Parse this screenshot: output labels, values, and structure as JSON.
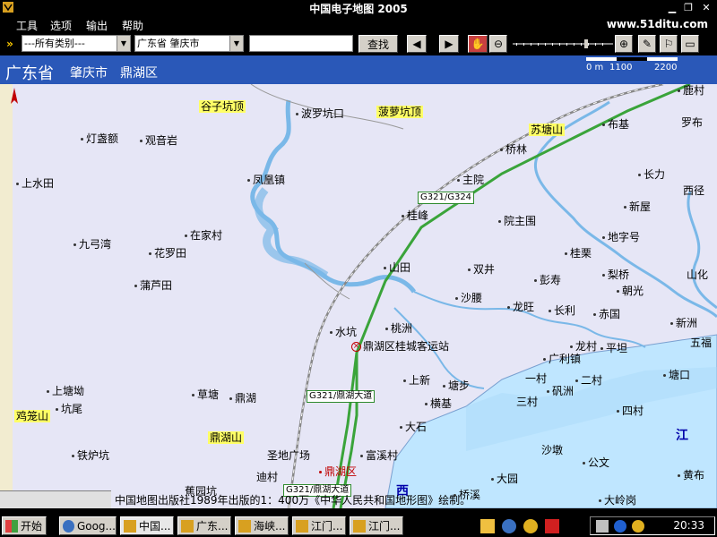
{
  "window": {
    "title": "中国电子地图 2005"
  },
  "menu": {
    "items": [
      "工具",
      "选项",
      "输出",
      "帮助"
    ],
    "site": "www.51ditu.com"
  },
  "toolbar": {
    "category_select": "---所有类别---",
    "region_select": "广东省  肇庆市",
    "search_value": "",
    "search_button": "查找"
  },
  "map_header": {
    "province": "广东省",
    "city": "肇庆市",
    "district": "鼎湖区"
  },
  "scale": {
    "t0": "0 m",
    "t1": "1100",
    "t2": "2200"
  },
  "places": {
    "boluokengkou": "波罗坑口",
    "dengzhane": "灯盏额",
    "guanyinyan": "观音岩",
    "shangshuitian": "上水田",
    "fenghuangzhen": "凤凰镇",
    "jiugongwan": "九弓湾",
    "zaijiacun": "在家村",
    "hualuotian": "花罗田",
    "puluotian": "蒲芦田",
    "shangtangyuan": "上塘坳",
    "kengwei": "坑尾",
    "tielupo": "铁炉坑",
    "caotang": "草塘",
    "dinghu": "鼎湖",
    "youcun": "迪村",
    "shuikeng": "水坑",
    "taozhou": "桃洲",
    "shanggtian": "山田",
    "guifeng": "桂峰",
    "zhuyuan": "主院",
    "qiaolin": "桥林",
    "yuanzhuwei": "院主围",
    "shuangjing": "双井",
    "shayao": "沙腰",
    "longwang": "龙旺",
    "pengshou": "彭寿",
    "changli": "长利",
    "chiguo": "赤国",
    "lizhuang": "梨桥",
    "zhaoguang": "朝光",
    "guixi": "桂栗",
    "dizihao": "地字号",
    "xinwu": "新屋",
    "changli2": "长力",
    "xiwei": "西径",
    "shanhua": "山化",
    "xinzhou": "新洲",
    "wufu": "五福",
    "tangkou": "塘口",
    "longcun": "龙村",
    "pingtan": "平坦",
    "guangli": "广利镇",
    "shangxin": "上新",
    "tangbu": "塘步",
    "hengji": "横基",
    "dashi": "大石",
    "yicun": "一村",
    "ercun": "二村",
    "sancun": "三村",
    "sicun": "四村",
    "chiwei": "矾洲",
    "fuxicun": "富溪村",
    "shadun": "沙墩",
    "gongwen": "公文",
    "dayuan": "大园",
    "qiaoxi": "桥溪",
    "daling": "大岭岗",
    "huangxin": "黄布",
    "dingfu": "蕉园坑",
    "luoyuan": "罗布",
    "bulu": "布基",
    "lieshu": "鹿村",
    "dinghuqu": "鼎湖区",
    "station": "鼎湖区桂城客运站",
    "shengdi": "圣地广场"
  },
  "mountains": {
    "guzikengding": "谷子坑顶",
    "boluokengding": "菠萝坑顶",
    "sutangshan": "苏塘山",
    "yingwushan": "鸡笼山",
    "dinghushan": "鼎湖山"
  },
  "roads": {
    "g321_g324": "G321/G324",
    "g321_dinghu1": "G321/鼎湖大道",
    "g321_dinghu2": "G321/鼎湖大道"
  },
  "water": {
    "jiang": "江",
    "xi": "西"
  },
  "copyright": "中国地图出版社1989年出版的1：400万《中华人民共和国地形图》绘制。",
  "taskbar": {
    "start": "开始",
    "buttons": [
      "Goog...",
      "中国...",
      "广东...",
      "海峡...",
      "江门...",
      "江门..."
    ],
    "clock": "20:33"
  },
  "colors": {
    "map_bg": "#e6e6f6",
    "water": "#bfe6ff",
    "road_green": "#3aa43a",
    "header_blue": "#2a58b8"
  }
}
